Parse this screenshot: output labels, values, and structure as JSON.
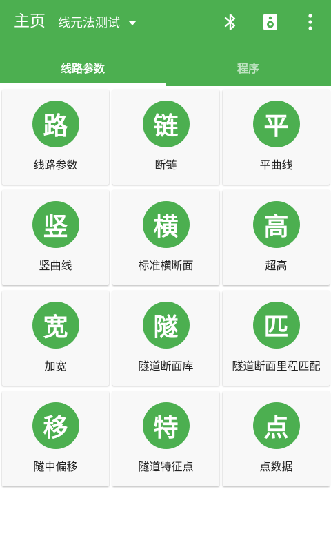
{
  "toolbar": {
    "title": "主页",
    "project": "线元法测试",
    "icons": [
      "bluetooth-icon",
      "speaker-icon",
      "more-vert-icon"
    ]
  },
  "tabs": [
    {
      "label": "线路参数",
      "active": true
    },
    {
      "label": "程序",
      "active": false
    }
  ],
  "grid": {
    "items": [
      {
        "glyph": "路",
        "label": "线路参数"
      },
      {
        "glyph": "链",
        "label": "断链"
      },
      {
        "glyph": "平",
        "label": "平曲线"
      },
      {
        "glyph": "竖",
        "label": "竖曲线"
      },
      {
        "glyph": "横",
        "label": "标准横断面"
      },
      {
        "glyph": "高",
        "label": "超高"
      },
      {
        "glyph": "宽",
        "label": "加宽"
      },
      {
        "glyph": "隧",
        "label": "隧道断面库"
      },
      {
        "glyph": "匹",
        "label": "隧道断面里程匹配"
      },
      {
        "glyph": "移",
        "label": "隧中偏移"
      },
      {
        "glyph": "特",
        "label": "隧道特征点"
      },
      {
        "glyph": "点",
        "label": "点数据"
      }
    ]
  },
  "colors": {
    "primary": "#4caf50",
    "tile_bg": "#f8f8f8"
  }
}
